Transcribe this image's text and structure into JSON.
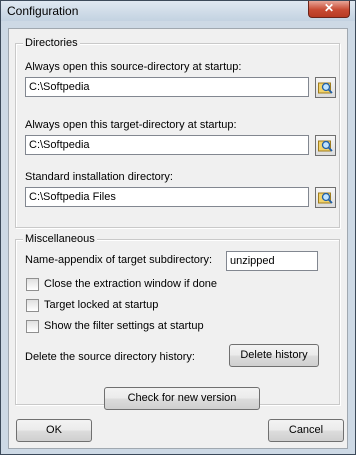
{
  "window": {
    "title": "Configuration",
    "close_glyph": "✕"
  },
  "directories": {
    "legend": "Directories",
    "source": {
      "label": "Always open this source-directory at startup:",
      "value": "C:\\Softpedia"
    },
    "target": {
      "label": "Always open this target-directory at startup:",
      "value": "C:\\Softpedia"
    },
    "install": {
      "label": "Standard installation directory:",
      "value": "C:\\Softpedia Files"
    },
    "browse_icon": "folder-search-icon"
  },
  "misc": {
    "legend": "Miscellaneous",
    "appendix_label": "Name-appendix of target subdirectory:",
    "appendix_value": "unzipped",
    "checkboxes": [
      {
        "label": "Close the extraction window if done",
        "checked": false
      },
      {
        "label": "Target locked at startup",
        "checked": false
      },
      {
        "label": "Show the filter settings at startup",
        "checked": false
      }
    ],
    "history_label": "Delete the source directory history:",
    "history_button": "Delete history"
  },
  "buttons": {
    "check_version": "Check for new version",
    "ok": "OK",
    "cancel": "Cancel"
  }
}
